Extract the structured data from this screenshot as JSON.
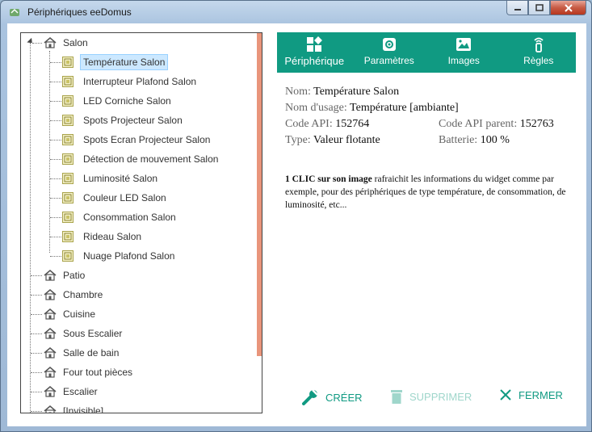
{
  "window": {
    "title": "Périphériques eeDomus"
  },
  "tree": {
    "root": {
      "label": "Salon"
    },
    "children": [
      {
        "label": "Température Salon",
        "selected": true
      },
      {
        "label": "Interrupteur Plafond Salon"
      },
      {
        "label": "LED Corniche Salon"
      },
      {
        "label": "Spots Projecteur Salon"
      },
      {
        "label": "Spots Ecran Projecteur Salon"
      },
      {
        "label": "Détection de mouvement Salon"
      },
      {
        "label": "Luminosité Salon"
      },
      {
        "label": "Couleur LED Salon"
      },
      {
        "label": "Consommation Salon"
      },
      {
        "label": "Rideau Salon"
      },
      {
        "label": "Nuage Plafond Salon"
      }
    ],
    "rooms": [
      {
        "label": "Patio"
      },
      {
        "label": "Chambre"
      },
      {
        "label": "Cuisine"
      },
      {
        "label": "Sous Escalier"
      },
      {
        "label": "Salle de bain"
      },
      {
        "label": "Four tout pièces"
      },
      {
        "label": "Escalier"
      },
      {
        "label": "[Invisible]"
      }
    ]
  },
  "toolbar": {
    "tabs": [
      {
        "label": "Périphérique",
        "icon": "widgets-icon",
        "active": true
      },
      {
        "label": "Paramètres",
        "icon": "gear-icon"
      },
      {
        "label": "Images",
        "icon": "image-icon"
      },
      {
        "label": "Règles",
        "icon": "remote-icon"
      }
    ],
    "color": "#109a82"
  },
  "details": {
    "nom_key": "Nom:",
    "nom_val": "Température Salon",
    "usage_key": "Nom d'usage:",
    "usage_val": "Température [ambiante]",
    "api_key": "Code API:",
    "api_val": "152764",
    "api_parent_key": "Code API parent:",
    "api_parent_val": "152763",
    "type_key": "Type:",
    "type_val": "Valeur flotante",
    "battery_key": "Batterie:",
    "battery_val": "100 %"
  },
  "description": {
    "bold": "1 CLIC sur son image",
    "text": " rafraichit les informations du widget comme par exemple, pour des périphériques de type température, de consommation, de luminosité, etc..."
  },
  "actions": {
    "create": "CRÉER",
    "delete": "SUPPRIMER",
    "close": "FERMER",
    "accent": "#109a82",
    "disabled": "#9fd6cb"
  }
}
